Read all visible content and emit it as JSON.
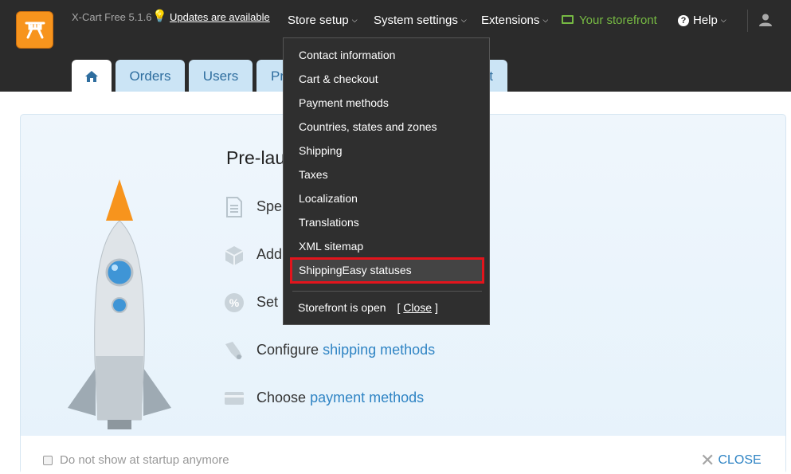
{
  "header": {
    "version": "X-Cart Free 5.1.6",
    "updates_link": "Updates are available",
    "nav": {
      "store_setup": "Store setup",
      "system_settings": "System settings",
      "extensions": "Extensions",
      "storefront": "Your storefront",
      "help": "Help"
    }
  },
  "tabs": {
    "orders": "Orders",
    "users": "Users",
    "products_partial": "Pr",
    "content_partial": "t"
  },
  "dropdown": {
    "items": [
      "Contact information",
      "Cart & checkout",
      "Payment methods",
      "Countries, states and zones",
      "Shipping",
      "Taxes",
      "Localization",
      "Translations",
      "XML sitemap",
      "ShippingEasy statuses"
    ],
    "status_text": "Storefront is open",
    "close_link": "Close",
    "bracket_open": "[",
    "bracket_close": "]"
  },
  "prelaunch": {
    "title": "Pre-launch",
    "tasks": [
      {
        "prefix": "Spe",
        "link": ""
      },
      {
        "prefix": "Add",
        "link": ""
      },
      {
        "prefix": "Set",
        "link": ""
      },
      {
        "prefix": "Configure",
        "link": "shipping methods"
      },
      {
        "prefix": "Choose",
        "link": "payment methods"
      }
    ]
  },
  "footer": {
    "dont_show": "Do not show at startup anymore",
    "close": "CLOSE"
  },
  "colors": {
    "topbar": "#2b2b2b",
    "accent_orange": "#f7941d",
    "storefront_green": "#76b943",
    "link_blue": "#2f84c4",
    "highlight_red": "#e3141c"
  }
}
